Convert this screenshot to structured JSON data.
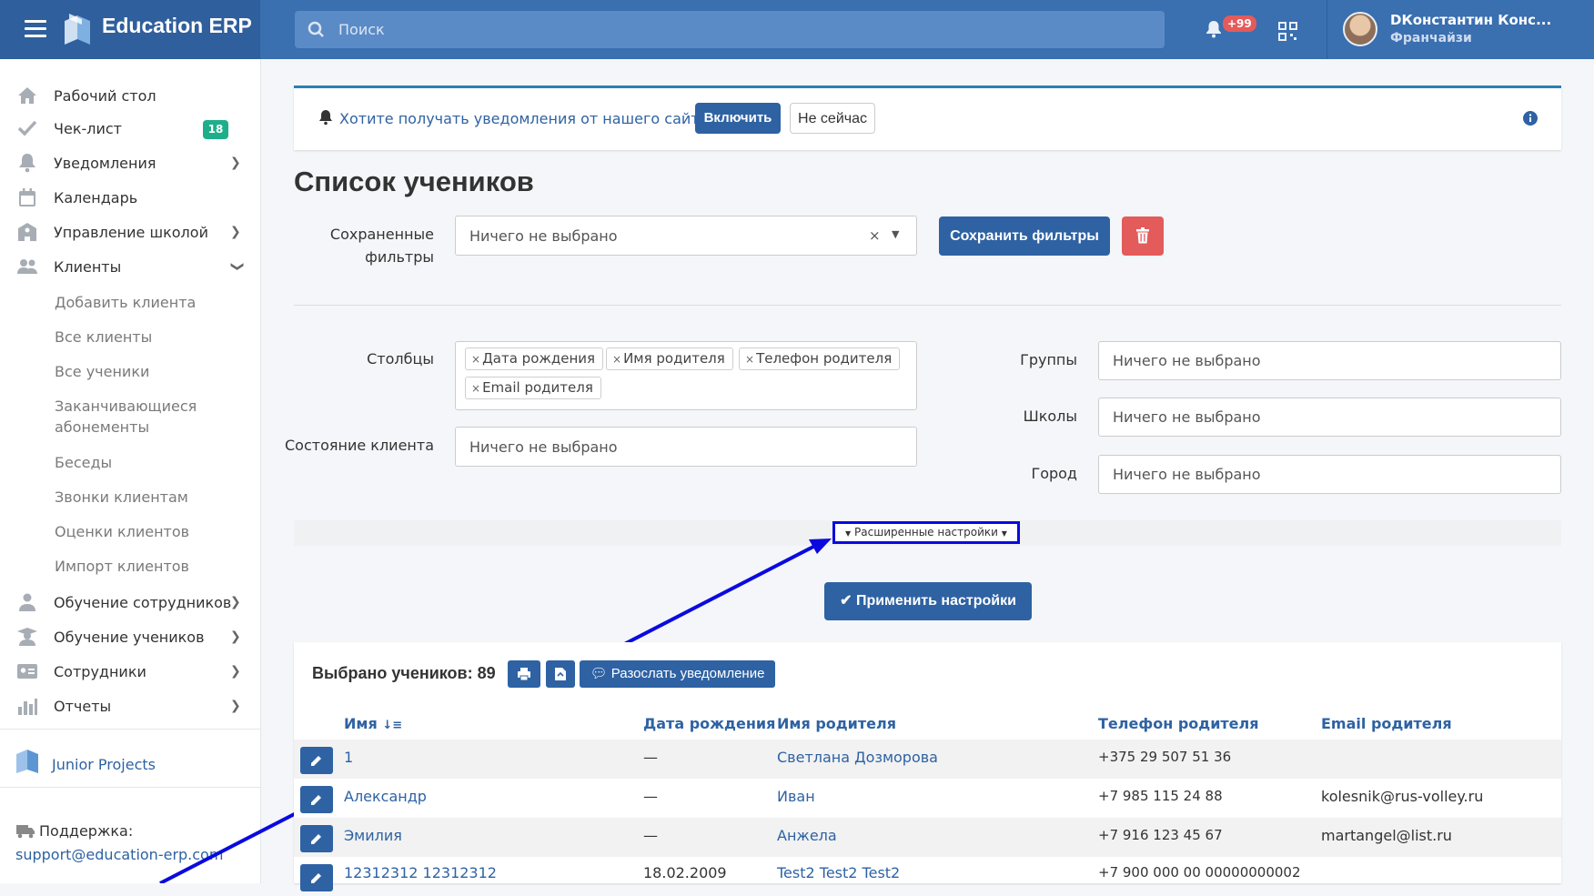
{
  "app": {
    "brand": "Education ERP"
  },
  "search": {
    "placeholder": "Поиск"
  },
  "header": {
    "notif_badge": "+99",
    "user_name": "DКонстантин Конс...",
    "user_role": "Франчайзи"
  },
  "sidebar": {
    "items": [
      {
        "label": "Рабочий стол"
      },
      {
        "label": "Чек-лист",
        "badge": "18"
      },
      {
        "label": "Уведомления"
      },
      {
        "label": "Календарь"
      },
      {
        "label": "Управление школой"
      },
      {
        "label": "Клиенты"
      },
      {
        "label": "Обучение сотрудников"
      },
      {
        "label": "Обучение учеников"
      },
      {
        "label": "Сотрудники"
      },
      {
        "label": "Отчеты"
      }
    ],
    "sub_items": [
      "Добавить клиента",
      "Все клиенты",
      "Все ученики",
      "Заканчивающиеся абонементы",
      "Беседы",
      "Звонки клиентам",
      "Оценки клиентов",
      "Импорт клиентов"
    ],
    "project": "Junior Projects",
    "support_label": "Поддержка:",
    "support_email": "support@education-erp.com"
  },
  "notification_bar": {
    "text": "Хотите получать уведомления от нашего сайта?",
    "enable_label": "Включить",
    "later_label": "Не сейчас"
  },
  "page": {
    "title": "Список учеников"
  },
  "filters": {
    "saved_label_1": "Сохраненные",
    "saved_label_2": "фильтры",
    "saved_value": "Ничего не выбрано",
    "save_button": "Сохранить фильтры",
    "columns_label": "Столбцы",
    "columns_tags": [
      "Дата рождения",
      "Имя родителя",
      "Телефон родителя",
      "Email родителя"
    ],
    "state_label": "Состояние клиента",
    "state_placeholder": "Ничего не выбрано",
    "groups_label": "Группы",
    "groups_placeholder": "Ничего не выбрано",
    "schools_label": "Школы",
    "schools_placeholder": "Ничего не выбрано",
    "city_label": "Город",
    "city_placeholder": "Ничего не выбрано",
    "advanced_label": "Расширенные настройки",
    "apply_label": "Применить настройки"
  },
  "table": {
    "selected_text": "Выбрано учеников: 89",
    "broadcast_label": "Разослать уведомление",
    "headers": [
      "Имя",
      "Дата рождения",
      "Имя родителя",
      "Телефон родителя",
      "Email родителя"
    ],
    "rows": [
      {
        "name": "1",
        "birth": "—",
        "parent": "Светлана Дозморова",
        "phone": "+375 29 507 51 36",
        "email": ""
      },
      {
        "name": "Александр",
        "birth": "—",
        "parent": "Иван",
        "phone": "+7 985 115 24 88",
        "email": "kolesnik@rus-volley.ru"
      },
      {
        "name": "Эмилия",
        "birth": "—",
        "parent": "Анжела",
        "phone": "+7 916 123 45 67",
        "email": "martangel@list.ru"
      },
      {
        "name": "12312312 12312312",
        "birth": "18.02.2009",
        "parent": "Test2 Test2 Test2",
        "phone": "+7 900 000 00 00000000002",
        "email": ""
      }
    ]
  },
  "colors": {
    "primary": "#2e62a3",
    "topbar": "#3a6fb0",
    "danger": "#e35b5b",
    "annotation": "#0a0adf"
  }
}
